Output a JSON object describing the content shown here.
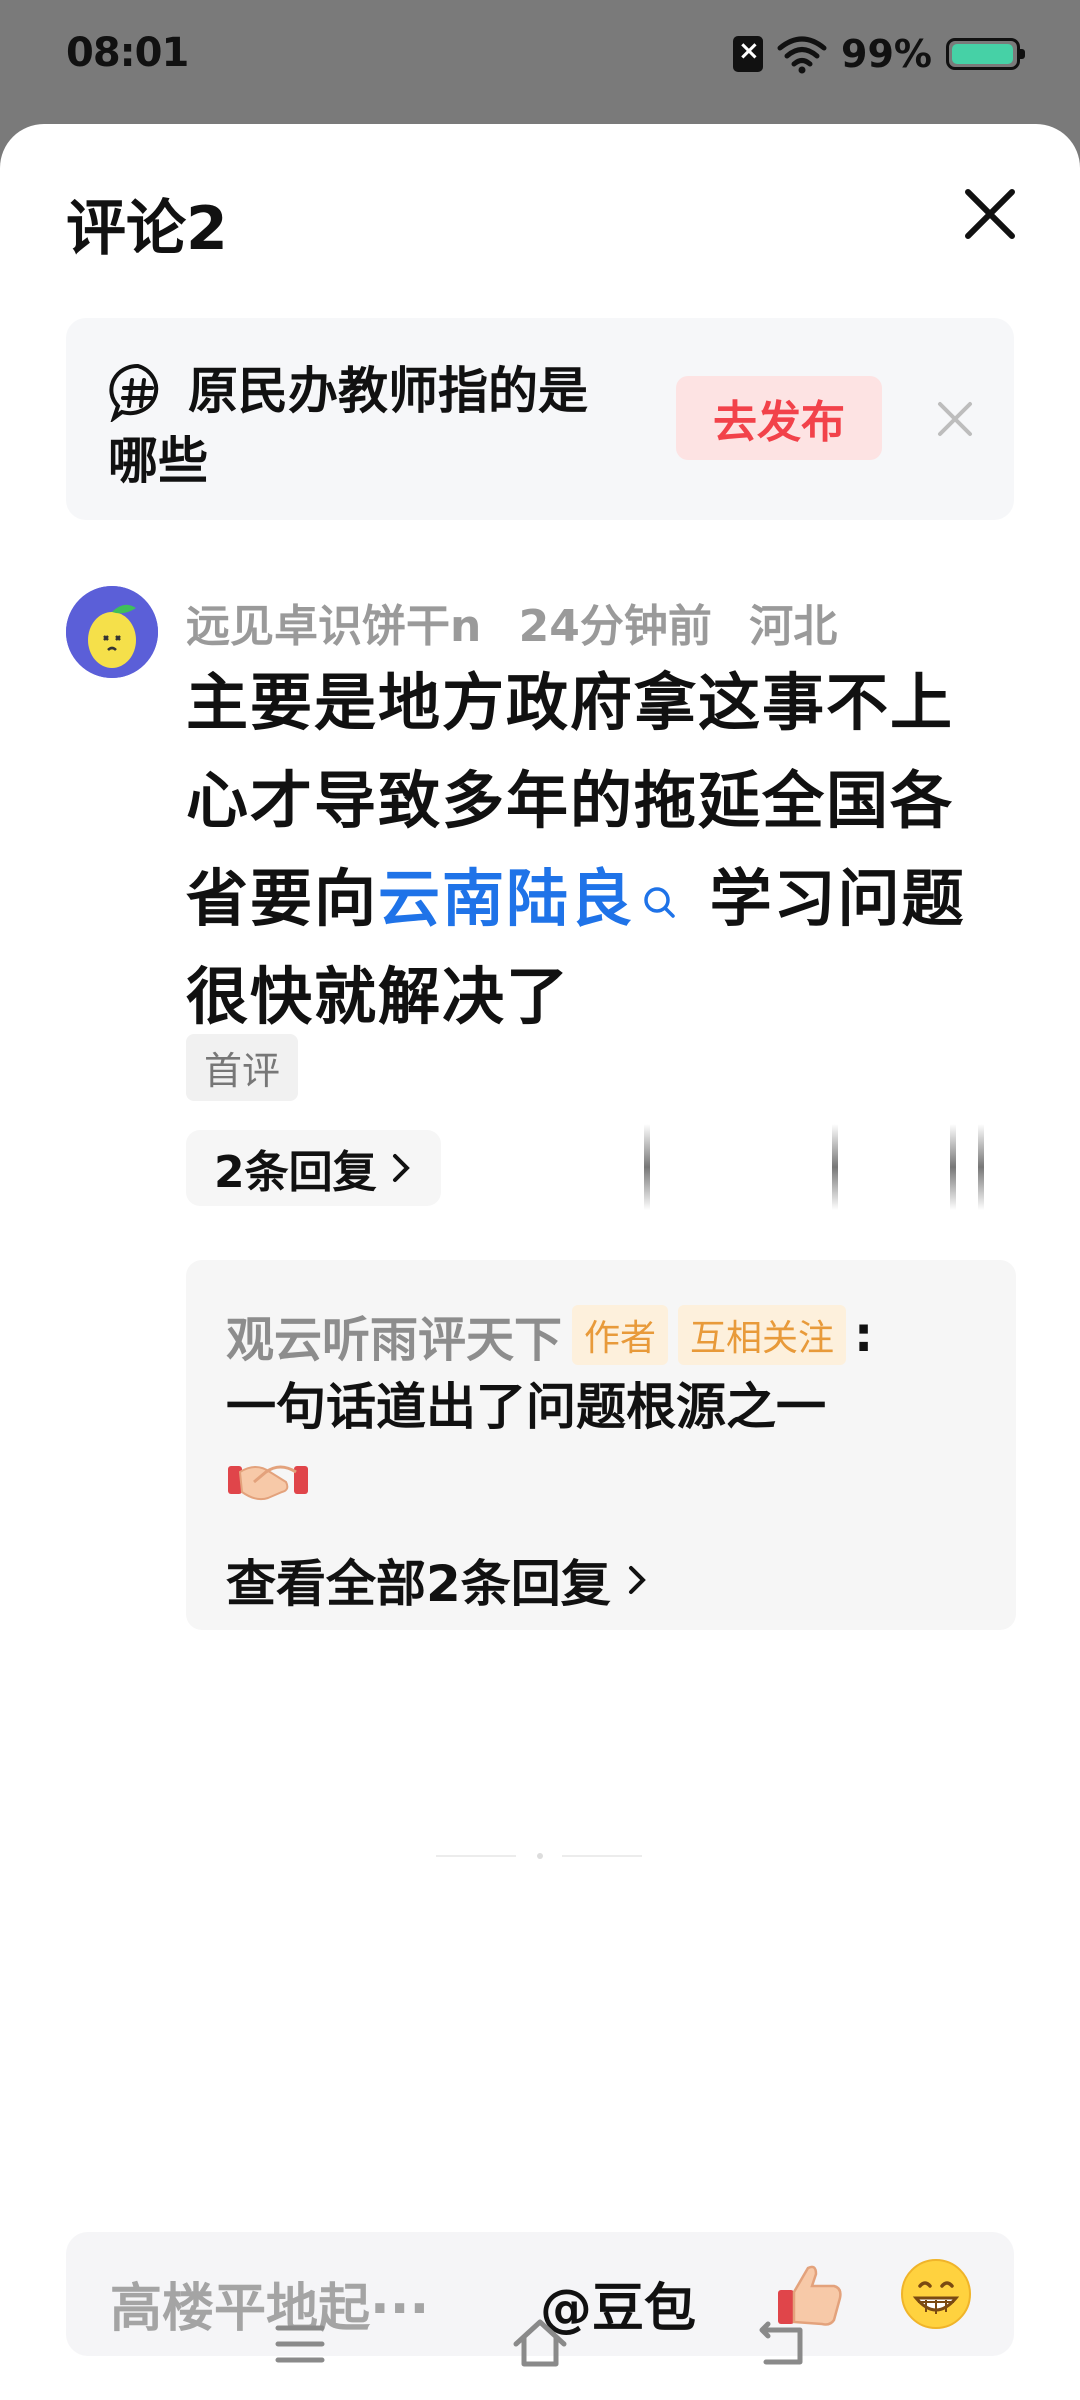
{
  "status_bar": {
    "time": "08:01",
    "battery": "99%",
    "battery_level": 0.99,
    "battery_color": "#46d1a6"
  },
  "sheet": {
    "title": "评论2"
  },
  "topic": {
    "text": "原民办教师指的是哪些",
    "publish_label": "去发布"
  },
  "comment": {
    "author": "远见卓识饼干n",
    "time": "24分钟前",
    "location": "河北",
    "text_before": "主要是地方政府拿这事不上心才导致多年的拖延全国各省要向",
    "link": "云南陆良",
    "text_after": " 学习问题很快就解决了",
    "badge": "首评",
    "replies_label": "2条回复"
  },
  "reply": {
    "author": "观云听雨评天下",
    "tag_author": "作者",
    "tag_follow": "互相关注",
    "colon": ":",
    "text": "一句话道出了问题根源之一",
    "view_all": "查看全部2条回复"
  },
  "input": {
    "placeholder": "高楼平地起···",
    "mention": "@豆包"
  },
  "colors": {
    "accent_red": "#f2424a",
    "link_blue": "#1f73e8",
    "tag_orange": "#e89a3a"
  },
  "icons": [
    "hash-icon",
    "close-icon",
    "search-icon",
    "chevron-right-icon",
    "handshake-icon",
    "thumbs-up-icon",
    "grin-icon",
    "menu-icon",
    "home-icon",
    "back-icon"
  ]
}
